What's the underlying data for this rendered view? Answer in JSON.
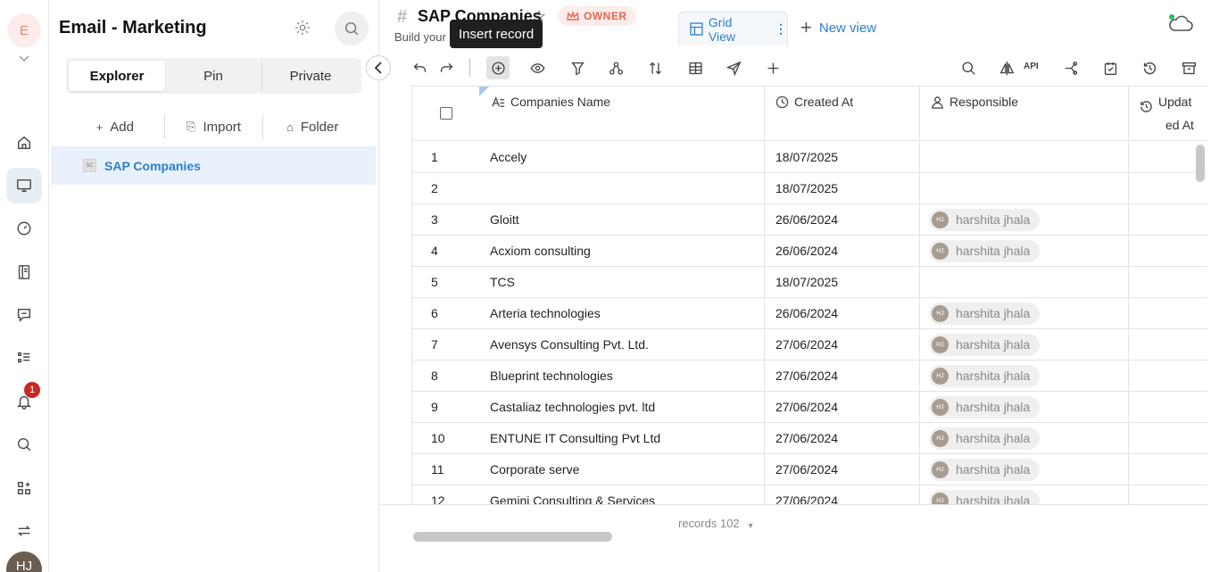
{
  "workspace": {
    "initial": "E"
  },
  "rail": {
    "notification_count": "1",
    "user_initials": "HJ",
    "items": [
      "home-icon",
      "desktop-icon",
      "gauge-icon",
      "book-icon",
      "chat-icon",
      "list-icon",
      "bell-icon",
      "search-icon",
      "apps-icon",
      "swap-icon"
    ]
  },
  "sidebar": {
    "title": "Email - Marketing",
    "tabs": [
      {
        "label": "Explorer",
        "active": true
      },
      {
        "label": "Pin"
      },
      {
        "label": "Private"
      }
    ],
    "actions": [
      {
        "icon": "+",
        "label": "Add"
      },
      {
        "icon": "⎘",
        "label": "Import"
      },
      {
        "icon": "⌂",
        "label": "Folder"
      }
    ],
    "tree": [
      {
        "badge": "SC",
        "label": "SAP Companies",
        "selected": true
      }
    ]
  },
  "header": {
    "hash": "#",
    "title": "SAP Companies",
    "owner_badge": "OWNER",
    "subtitle": "Build your",
    "tooltip": "Insert record",
    "view_tab": "Grid View",
    "new_view": "New view"
  },
  "toolbar": {
    "api_label": "API",
    "left_icons": [
      "undo-icon",
      "redo-icon",
      "insert-record-icon",
      "eye-icon",
      "filter-icon",
      "group-icon",
      "sort-icon",
      "layout-icon",
      "send-icon",
      "add-field-icon"
    ],
    "right_icons": [
      "search-icon",
      "compare-icon",
      "api-icon",
      "share-icon",
      "calendar-icon",
      "history-icon",
      "archive-icon"
    ]
  },
  "grid": {
    "columns": [
      {
        "label": "Companies Name",
        "icon": "text-field-icon"
      },
      {
        "label": "Created At",
        "icon": "clock-icon"
      },
      {
        "label": "Responsible",
        "icon": "user-icon"
      },
      {
        "label": "Updat",
        "label2": "ed At",
        "icon": "history-icon"
      }
    ],
    "rows": [
      {
        "n": "1",
        "name": "Accely",
        "created": "18/07/2025",
        "resp": "",
        "resp_initials": ""
      },
      {
        "n": "2",
        "name": "",
        "created": "18/07/2025",
        "resp": "",
        "resp_initials": ""
      },
      {
        "n": "3",
        "name": "Gloitt",
        "created": "26/06/2024",
        "resp": "harshita jhala",
        "resp_initials": "HJ"
      },
      {
        "n": "4",
        "name": "Acxiom consulting",
        "created": "26/06/2024",
        "resp": "harshita jhala",
        "resp_initials": "HJ"
      },
      {
        "n": "5",
        "name": "TCS",
        "created": "18/07/2025",
        "resp": "",
        "resp_initials": ""
      },
      {
        "n": "6",
        "name": "Arteria technologies",
        "created": "26/06/2024",
        "resp": "harshita jhala",
        "resp_initials": "HJ"
      },
      {
        "n": "7",
        "name": "Avensys Consulting Pvt. Ltd.",
        "created": "27/06/2024",
        "resp": "harshita jhala",
        "resp_initials": "HJ"
      },
      {
        "n": "8",
        "name": "Blueprint technologies",
        "created": "27/06/2024",
        "resp": "harshita jhala",
        "resp_initials": "HJ"
      },
      {
        "n": "9",
        "name": "Castaliaz technologies pvt. ltd",
        "created": "27/06/2024",
        "resp": "harshita jhala",
        "resp_initials": "HJ"
      },
      {
        "n": "10",
        "name": "ENTUNE IT Consulting Pvt Ltd",
        "created": "27/06/2024",
        "resp": "harshita jhala",
        "resp_initials": "HJ"
      },
      {
        "n": "11",
        "name": "Corporate serve",
        "created": "27/06/2024",
        "resp": "harshita jhala",
        "resp_initials": "HJ"
      },
      {
        "n": "12",
        "name": "Gemini Consulting & Services",
        "created": "27/06/2024",
        "resp": "harshita jhala",
        "resp_initials": "HJ"
      }
    ]
  },
  "footer": {
    "records": "records 102"
  },
  "colors": {
    "accent": "#2d7fc9",
    "owner": "#e5674f",
    "badge": "#c62828",
    "selected_row": "#e8f1fb"
  }
}
